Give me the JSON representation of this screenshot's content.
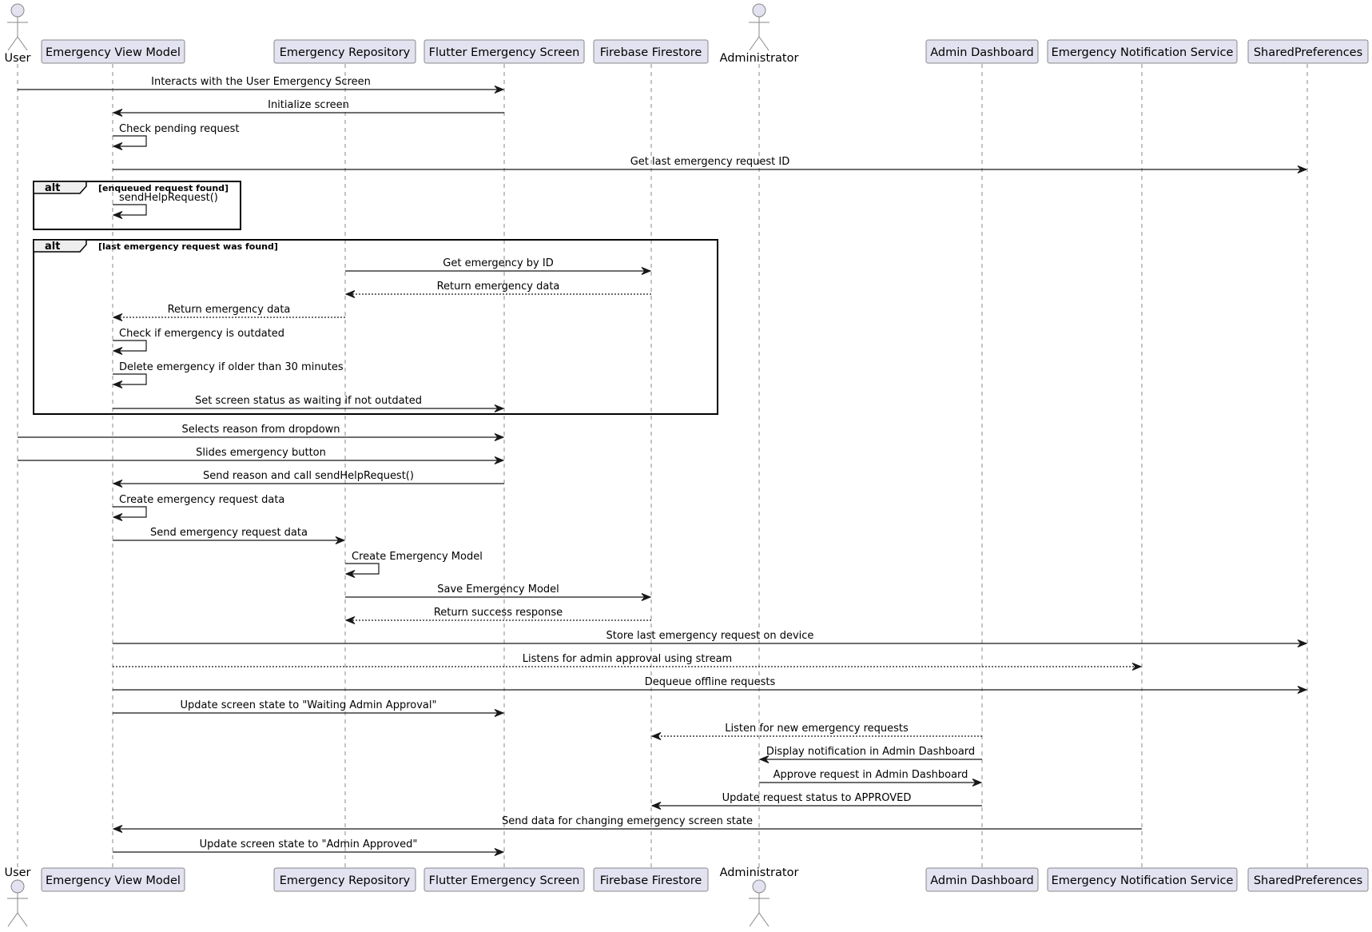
{
  "diagram": {
    "type": "sequence",
    "participants": [
      {
        "id": "user",
        "label": "User",
        "kind": "actor"
      },
      {
        "id": "evm",
        "label": "Emergency View Model",
        "kind": "participant"
      },
      {
        "id": "repo",
        "label": "Emergency Repository",
        "kind": "participant"
      },
      {
        "id": "screen",
        "label": "Flutter Emergency Screen",
        "kind": "participant"
      },
      {
        "id": "firestore",
        "label": "Firebase Firestore",
        "kind": "participant"
      },
      {
        "id": "admin",
        "label": "Administrator",
        "kind": "actor"
      },
      {
        "id": "dashboard",
        "label": "Admin Dashboard",
        "kind": "participant"
      },
      {
        "id": "notif",
        "label": "Emergency Notification Service",
        "kind": "participant"
      },
      {
        "id": "prefs",
        "label": "SharedPreferences",
        "kind": "participant"
      }
    ],
    "messages": [
      {
        "from": "user",
        "to": "screen",
        "label": "Interacts with the User Emergency Screen",
        "style": "solid"
      },
      {
        "from": "screen",
        "to": "evm",
        "label": "Initialize screen",
        "style": "solid"
      },
      {
        "from": "evm",
        "to": "evm",
        "label": "Check pending request",
        "style": "solid"
      },
      {
        "from": "evm",
        "to": "prefs",
        "label": "Get last emergency request ID",
        "style": "solid"
      },
      {
        "from": "evm",
        "to": "evm",
        "label": "sendHelpRequest()",
        "style": "solid",
        "frame": 0
      },
      {
        "from": "repo",
        "to": "firestore",
        "label": "Get emergency by ID",
        "style": "solid",
        "frame": 1
      },
      {
        "from": "firestore",
        "to": "repo",
        "label": "Return emergency data",
        "style": "dashed",
        "frame": 1
      },
      {
        "from": "repo",
        "to": "evm",
        "label": "Return emergency data",
        "style": "dashed",
        "frame": 1
      },
      {
        "from": "evm",
        "to": "evm",
        "label": "Check if emergency is outdated",
        "style": "solid",
        "frame": 1
      },
      {
        "from": "evm",
        "to": "evm",
        "label": "Delete emergency if older than 30 minutes",
        "style": "solid",
        "frame": 1
      },
      {
        "from": "evm",
        "to": "screen",
        "label": "Set screen status as waiting if not outdated",
        "style": "solid",
        "frame": 1
      },
      {
        "from": "user",
        "to": "screen",
        "label": "Selects reason from dropdown",
        "style": "solid"
      },
      {
        "from": "user",
        "to": "screen",
        "label": "Slides emergency button",
        "style": "solid"
      },
      {
        "from": "screen",
        "to": "evm",
        "label": "Send reason and call sendHelpRequest()",
        "style": "solid"
      },
      {
        "from": "evm",
        "to": "evm",
        "label": "Create emergency request data",
        "style": "solid"
      },
      {
        "from": "evm",
        "to": "repo",
        "label": "Send emergency request data",
        "style": "solid"
      },
      {
        "from": "repo",
        "to": "repo",
        "label": "Create Emergency Model",
        "style": "solid"
      },
      {
        "from": "repo",
        "to": "firestore",
        "label": "Save Emergency Model",
        "style": "solid"
      },
      {
        "from": "firestore",
        "to": "repo",
        "label": "Return success response",
        "style": "dashed"
      },
      {
        "from": "evm",
        "to": "prefs",
        "label": "Store last emergency request on device",
        "style": "solid"
      },
      {
        "from": "evm",
        "to": "notif",
        "label": "Listens for admin approval using stream",
        "style": "dashed"
      },
      {
        "from": "evm",
        "to": "prefs",
        "label": "Dequeue offline requests",
        "style": "solid"
      },
      {
        "from": "evm",
        "to": "screen",
        "label": "Update screen state to \"Waiting Admin Approval\"",
        "style": "solid"
      },
      {
        "from": "dashboard",
        "to": "firestore",
        "label": "Listen for new emergency requests",
        "style": "dashed"
      },
      {
        "from": "dashboard",
        "to": "admin",
        "label": "Display notification in Admin Dashboard",
        "style": "solid"
      },
      {
        "from": "admin",
        "to": "dashboard",
        "label": "Approve request in Admin Dashboard",
        "style": "solid"
      },
      {
        "from": "dashboard",
        "to": "firestore",
        "label": "Update request status to APPROVED",
        "style": "solid"
      },
      {
        "from": "notif",
        "to": "evm",
        "label": "Send data for changing emergency screen state",
        "style": "solid"
      },
      {
        "from": "evm",
        "to": "screen",
        "label": "Update screen state to \"Admin Approved\"",
        "style": "solid"
      }
    ],
    "frames": [
      {
        "keyword": "alt",
        "condition": "[enqueued request found]"
      },
      {
        "keyword": "alt",
        "condition": "[last emergency request was found]"
      }
    ],
    "colors": {
      "participant_fill": "#e2e2f0",
      "participant_border": "#888888",
      "arrow": "#181818",
      "frame_tab": "#eeeeee"
    }
  }
}
